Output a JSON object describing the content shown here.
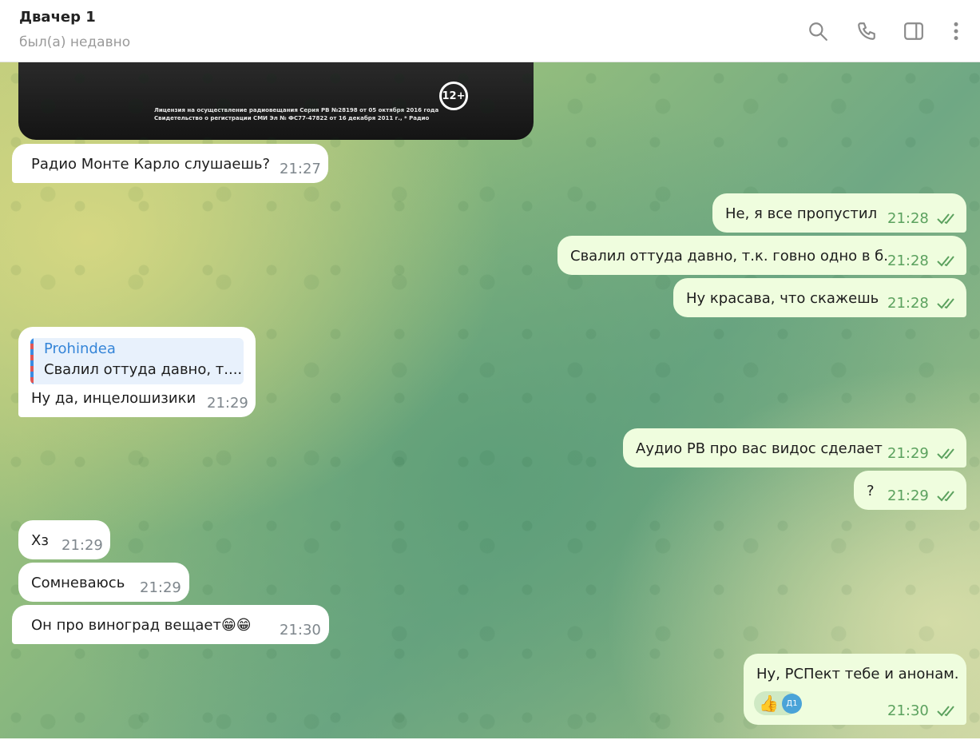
{
  "header": {
    "title": "Двачер 1",
    "status": "был(а) недавно"
  },
  "media": {
    "license_line1": "Лицензия на осуществление радиовещания Серия РВ №28198 от 05 октября 2016 года",
    "license_line2": "Свидетельство о регистрации СМИ Эл № ФС77-47822 от 16 декабря 2011 г., * Радио",
    "age_badge": "12+"
  },
  "messages": [
    {
      "side": "in",
      "text": "Радио Монте Карло слушаешь?",
      "time": "21:27"
    },
    {
      "side": "out",
      "text": "Не, я все пропустил",
      "time": "21:28"
    },
    {
      "side": "out",
      "text": "Свалил оттуда давно, т.к. говно одно в б.",
      "time": "21:28"
    },
    {
      "side": "out",
      "text": "Ну красава, что скажешь",
      "time": "21:28"
    },
    {
      "side": "in",
      "reply_name": "Prohindea",
      "reply_text": "Свалил оттуда давно, т....",
      "text": "Ну да, инцелошизики",
      "time": "21:29"
    },
    {
      "side": "out",
      "text": "Аудио РВ про вас видос сделает",
      "time": "21:29"
    },
    {
      "side": "out",
      "text": "?",
      "time": "21:29"
    },
    {
      "side": "in",
      "text": "Хз",
      "time": "21:29"
    },
    {
      "side": "in",
      "text": "Сомневаюсь",
      "time": "21:29"
    },
    {
      "side": "in",
      "text": "Он про виноград вещает😁😁",
      "time": "21:30"
    },
    {
      "side": "out",
      "text": "Ну, РСПект тебе и анонам.",
      "time": "21:30",
      "reaction": "👍",
      "reaction_avatar": "Д1"
    }
  ],
  "colors": {
    "incoming_bg": "#ffffff",
    "outgoing_bg": "#effdde",
    "outgoing_time": "#5ba15e",
    "reply_accent": "#3585d8"
  },
  "icons": [
    "search-icon",
    "phone-icon",
    "sidebar-toggle-icon",
    "more-vertical-icon",
    "double-check-icon"
  ]
}
